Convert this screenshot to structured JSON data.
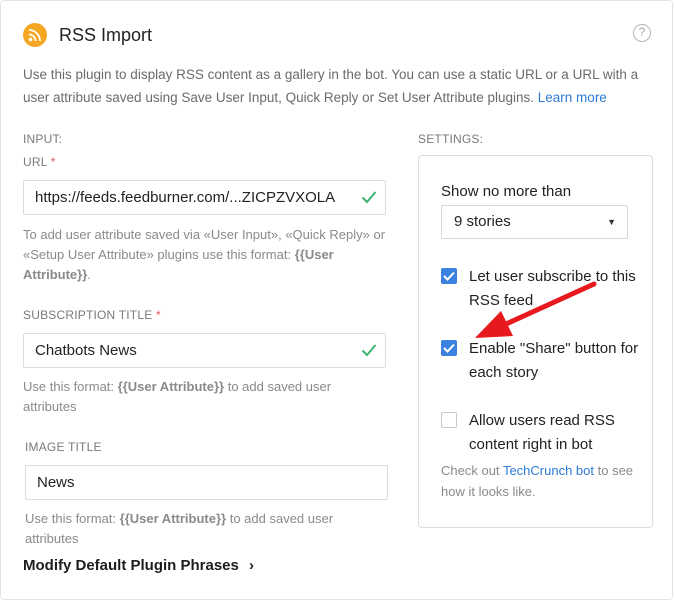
{
  "header": {
    "title": "RSS Import",
    "icon": "rss-icon",
    "help_glyph": "?"
  },
  "description": {
    "text": "Use this plugin to display RSS content as a gallery in the bot. You can use a static URL or a URL with a user attribute saved using Save User Input, Quick Reply or Set User Attribute plugins.",
    "link": "Learn more"
  },
  "input_section": {
    "label": "INPUT:",
    "url_label": "URL",
    "url_value": "https://feeds.feedburner.com/...ZICPZVXOLA",
    "url_hint_pre": "To add user attribute saved via «User Input», «Quick Reply» or «Setup User Attribute» plugins use this format:",
    "url_hint_code": "{{User Attribute}}",
    "url_hint_end": ".",
    "subscription_title_label": "SUBSCRIPTION TITLE",
    "subscription_title_value": "Chatbots News",
    "subscription_hint_pre": "Use this format:",
    "subscription_hint_code": "{{User Attribute}}",
    "subscription_hint_post": "to add saved user attributes",
    "image_title_label": "IMAGE TITLE",
    "image_title_value": "News",
    "image_hint_pre": "Use this format:",
    "image_hint_code": "{{User Attribute}}",
    "image_hint_post": "to add saved user attributes",
    "required_mark": "*"
  },
  "modify_link": "Modify Default Plugin Phrases",
  "modify_chevron": "›",
  "settings": {
    "label": "SETTINGS:",
    "show_label": "Show no more than",
    "stories_value": "9 stories",
    "caret": "▼",
    "options": [
      {
        "label": "Let user subscribe to this RSS feed",
        "checked": true
      },
      {
        "label": "Enable \"Share\" button for each story",
        "checked": true
      },
      {
        "label": "Allow users read RSS content right in bot",
        "checked": false
      }
    ],
    "note_pre": "Check out",
    "note_link": "TechCrunch bot",
    "note_post": "to see how it looks like."
  },
  "colors": {
    "accent": "#3b82e0",
    "link": "#2d7bd6",
    "rss_badge": "#f5a623",
    "valid_check": "#3cb371",
    "annotation_arrow": "#e8191e"
  }
}
